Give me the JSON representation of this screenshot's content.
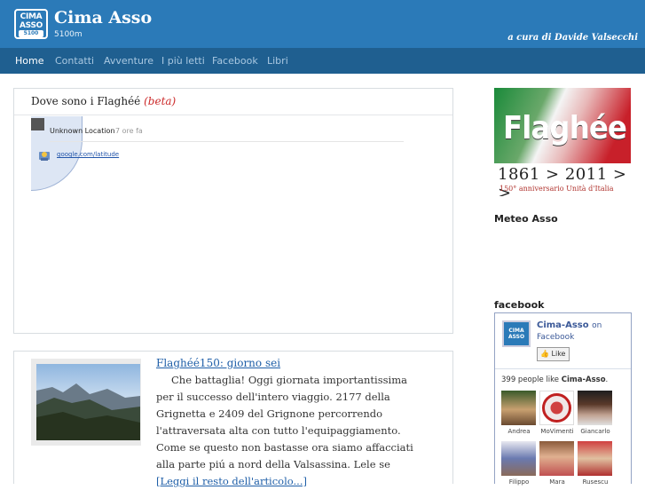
{
  "header": {
    "logo_line1": "CIMA",
    "logo_line2": "ASSO",
    "logo_line3": "5100",
    "title": "Cima Asso",
    "subtitle": "5100m",
    "byline": "a cura di Davide Valsecchi",
    "color": "#2b7ab8"
  },
  "nav": {
    "items": [
      "Home",
      "Contatti",
      "Avventure",
      "I più letti",
      "Facebook",
      "Libri"
    ],
    "active": "Home",
    "color": "#1f5f90"
  },
  "map_panel": {
    "title": "Dove sono i Flaghéé",
    "beta": "(beta)",
    "location_name": "Unknown Location",
    "time_ago": "7 ore fa",
    "link": "google.com/latitude"
  },
  "post": {
    "title": "Flaghéé150: giorno sei",
    "body": "Che battaglia! Oggi giornata importantissima per il successo dell'intero viaggio. 2177 della Grignetta e 2409 del Grignone percorrendo l'attraversata alta con tutto l'equipaggiamento. Come se questo non bastasse ora siamo affacciati alla parte piú a nord della Valsassina. Lele  se",
    "more": "[Leggi il resto dell'articolo...]"
  },
  "sidebar": {
    "banner_text": "Flaghée",
    "banner_years": "1861 > 2011 > >",
    "banner_anniversary": "150° anniversario Unità d'Italia",
    "meteo_heading": "Meteo Asso",
    "facebook_heading": "facebook",
    "fb": {
      "page_name": "Cima-Asso",
      "on": "on",
      "facebook": "Facebook",
      "like": "Like",
      "count_prefix": "399 people like",
      "count_page": "Cima-Asso",
      "count_suffix": ".",
      "fans": [
        "Andrea",
        "MoVimenti",
        "Giancarlo",
        "Filippo",
        "Mara",
        "Rusescu"
      ]
    }
  }
}
